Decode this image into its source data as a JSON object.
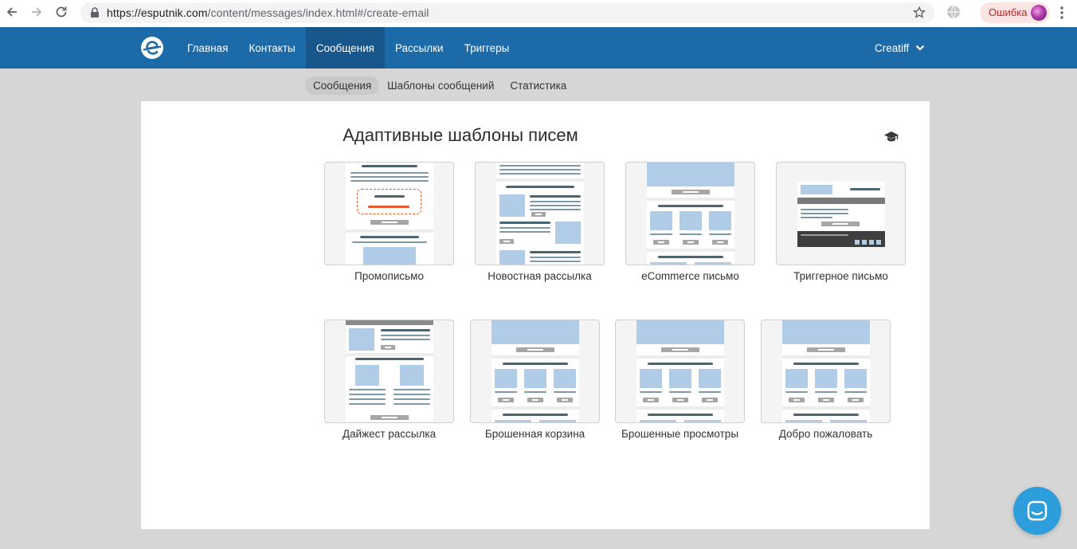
{
  "browser": {
    "url_host": "https://esputnik.com",
    "url_path": "/content/messages/index.html#/create-email",
    "error_label": "Ошибка"
  },
  "header": {
    "nav": [
      {
        "label": "Главная"
      },
      {
        "label": "Контакты"
      },
      {
        "label": "Сообщения",
        "active": true
      },
      {
        "label": "Рассылки"
      },
      {
        "label": "Триггеры"
      }
    ],
    "user_name": "Creatiff"
  },
  "subnav": [
    {
      "label": "Сообщения",
      "active": true
    },
    {
      "label": "Шаблоны сообщений"
    },
    {
      "label": "Статистика"
    }
  ],
  "main": {
    "title": "Адаптивные шаблоны писем",
    "templates": [
      {
        "label": "Промописьмо"
      },
      {
        "label": "Новостная рассылка"
      },
      {
        "label": "eCommerce письмо"
      },
      {
        "label": "Триггерное письмо"
      },
      {
        "label": "Дайжест рассылка"
      },
      {
        "label": "Брошенная корзина"
      },
      {
        "label": "Брошенные просмотры"
      },
      {
        "label": "Добро пожаловать"
      }
    ]
  },
  "colors": {
    "appbar": "#1d6aa8",
    "appbar_active": "#18578b",
    "thumb_block": "#b1cce6",
    "chat": "#2d9ddb"
  }
}
